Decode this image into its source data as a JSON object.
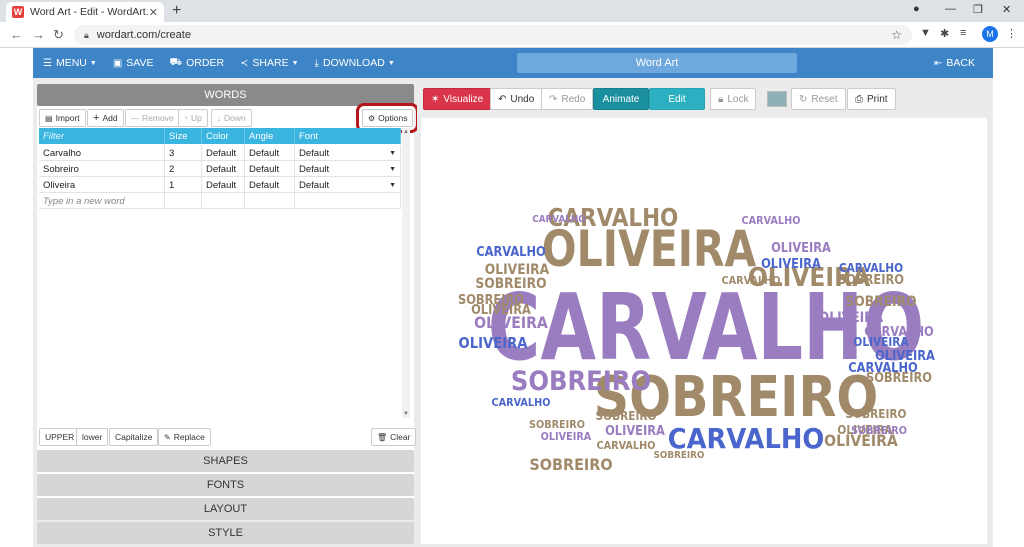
{
  "browser": {
    "tab_title": "Word Art - Edit - WordArt.com",
    "tab_favicon_letter": "W",
    "url": "wordart.com/create",
    "avatar_letter": "M"
  },
  "toolbar": {
    "menu": "MENU",
    "save": "SAVE",
    "order": "ORDER",
    "share": "SHARE",
    "download": "DOWNLOAD",
    "title": "Word Art",
    "back": "BACK"
  },
  "words_panel": {
    "header": "WORDS",
    "buttons": {
      "import": "Import",
      "add": "Add",
      "remove": "Remove",
      "up": "Up",
      "down": "Down",
      "options": "Options"
    },
    "table": {
      "filter_placeholder": "Filter",
      "columns": [
        "Size",
        "Color",
        "Angle",
        "Font"
      ],
      "rows": [
        {
          "word": "Carvalho",
          "size": "3",
          "color": "Default",
          "angle": "Default",
          "font": "Default"
        },
        {
          "word": "Sobreiro",
          "size": "2",
          "color": "Default",
          "angle": "Default",
          "font": "Default"
        },
        {
          "word": "Oliveira",
          "size": "1",
          "color": "Default",
          "angle": "Default",
          "font": "Default"
        }
      ],
      "new_word_placeholder": "Type in a new word"
    },
    "bottom_buttons": {
      "upper": "UPPER",
      "lower": "lower",
      "capitalize": "Capitalize",
      "replace": "Replace",
      "clear": "Clear"
    }
  },
  "sections": [
    "SHAPES",
    "FONTS",
    "LAYOUT",
    "STYLE"
  ],
  "canvas_toolbar": {
    "visualize": "Visualize",
    "undo": "Undo",
    "redo": "Redo",
    "animate": "Animate",
    "edit": "Edit",
    "lock": "Lock",
    "reset": "Reset",
    "print": "Print"
  },
  "colors": {
    "toolbar_blue": "#3d85c6",
    "table_header": "#3ab5e0",
    "options_highlight": "#b3161b",
    "word_purple": "#9a7cc0",
    "word_brown": "#a08a6a",
    "word_blue": "#4a66cc",
    "swatch": "#8fb0b6"
  },
  "wordcloud": [
    {
      "text": "CARVALHO",
      "color": "purple",
      "tone": "lead"
    },
    {
      "text": "SOBREIRO",
      "color": "brown",
      "tone": "large"
    },
    {
      "text": "OLIVEIRA",
      "color": "brown",
      "tone": "large"
    },
    {
      "text": "SOBREIRO",
      "color": "purple",
      "tone": "medium"
    },
    {
      "text": "CARVALHO",
      "color": "blue",
      "tone": "medium"
    },
    {
      "text": "CARVALHO",
      "color": "brown",
      "tone": "medium"
    },
    {
      "text": "OLIVEIRA",
      "color": "brown",
      "tone": "medium"
    },
    {
      "text": "SOBREIRO",
      "color": "brown",
      "tone": "small"
    },
    {
      "text": "OLIVEIRA",
      "color": "purple",
      "tone": "small"
    },
    {
      "text": "OLIVEIRA",
      "color": "blue",
      "tone": "small"
    },
    {
      "text": "OLIVEIRA",
      "color": "brown",
      "tone": "small"
    },
    {
      "text": "SOBREIRO",
      "color": "brown",
      "tone": "small"
    },
    {
      "text": "CARVALHO",
      "color": "blue",
      "tone": "small"
    },
    {
      "text": "OLIVEIRA",
      "color": "purple",
      "tone": "small"
    },
    {
      "text": "SOBREIRO",
      "color": "brown",
      "tone": "small"
    },
    {
      "text": "CARVALHO",
      "color": "purple",
      "tone": "small"
    },
    {
      "text": "OLIVEIRA",
      "color": "brown",
      "tone": "small"
    },
    {
      "text": "SOBREIRO",
      "color": "brown",
      "tone": "small"
    },
    {
      "text": "CARVALHO",
      "color": "blue",
      "tone": "small"
    },
    {
      "text": "OLIVEIRA",
      "color": "blue",
      "tone": "small"
    },
    {
      "text": "OLIVEIRA",
      "color": "brown",
      "tone": "small"
    },
    {
      "text": "SOBREIRO",
      "color": "brown",
      "tone": "small"
    },
    {
      "text": "OLIVEIRA",
      "color": "purple",
      "tone": "small"
    },
    {
      "text": "OLIVEIRA",
      "color": "blue",
      "tone": "small"
    },
    {
      "text": "SOBREIRO",
      "color": "brown",
      "tone": "small"
    },
    {
      "text": "CARVALHO",
      "color": "purple",
      "tone": "small"
    },
    {
      "text": "CARVALHO",
      "color": "blue",
      "tone": "small"
    },
    {
      "text": "SOBREIRO",
      "color": "brown",
      "tone": "small"
    },
    {
      "text": "OLIVEIRA",
      "color": "purple",
      "tone": "small"
    },
    {
      "text": "CARVALHO",
      "color": "brown",
      "tone": "small"
    },
    {
      "text": "SOBREIRO",
      "color": "brown",
      "tone": "small"
    },
    {
      "text": "CARVALHO",
      "color": "blue",
      "tone": "small"
    },
    {
      "text": "OLIVEIRA",
      "color": "purple",
      "tone": "small"
    },
    {
      "text": "OLIVEIRA",
      "color": "brown",
      "tone": "small"
    },
    {
      "text": "CARVALHO",
      "color": "purple",
      "tone": "small"
    },
    {
      "text": "SOBREIRO",
      "color": "brown",
      "tone": "small"
    },
    {
      "text": "SOBREIRO",
      "color": "purple",
      "tone": "small"
    },
    {
      "text": "CARVALHO",
      "color": "brown",
      "tone": "small"
    },
    {
      "text": "SOBREIRO",
      "color": "brown",
      "tone": "small"
    },
    {
      "text": "OLIVEIRA",
      "color": "blue",
      "tone": "small"
    }
  ]
}
